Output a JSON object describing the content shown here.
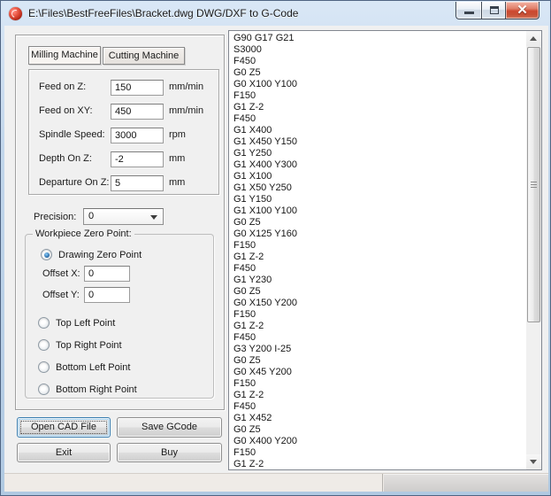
{
  "window": {
    "title": "E:\\Files\\BestFreeFiles\\Bracket.dwg DWG/DXF to G-Code",
    "icons": {
      "app": "red-disc-icon",
      "minimize": "minimize-icon",
      "maximize": "maximize-icon",
      "close": "close-icon"
    }
  },
  "tabs": [
    {
      "label": "Milling Machine",
      "active": true
    },
    {
      "label": "Cutting Machine",
      "active": false
    }
  ],
  "fields": [
    {
      "label": "Feed on Z:",
      "value": "150",
      "unit": "mm/min"
    },
    {
      "label": "Feed on XY:",
      "value": "450",
      "unit": "mm/min"
    },
    {
      "label": "Spindle Speed:",
      "value": "3000",
      "unit": "rpm"
    },
    {
      "label": "Depth On Z:",
      "value": "-2",
      "unit": "mm"
    },
    {
      "label": "Departure On Z:",
      "value": "5",
      "unit": "mm"
    }
  ],
  "precision": {
    "label": "Precision:",
    "value": "0"
  },
  "workpiece": {
    "title": "Workpiece Zero Point:",
    "drawing_radio": {
      "label": "Drawing Zero Point",
      "selected": true
    },
    "offsets": [
      {
        "label": "Offset X:",
        "value": "0"
      },
      {
        "label": "Offset Y:",
        "value": "0"
      }
    ],
    "corner_radios": [
      {
        "label": "Top Left Point",
        "selected": false
      },
      {
        "label": "Top Right Point",
        "selected": false
      },
      {
        "label": "Bottom Left Point",
        "selected": false
      },
      {
        "label": "Bottom Right Point",
        "selected": false
      }
    ]
  },
  "buttons": {
    "open": "Open CAD File",
    "save": "Save GCode",
    "exit": "Exit",
    "buy": "Buy"
  },
  "colors": {
    "accent_close": "#cc4830",
    "radio_selected": "#2f71ad",
    "default_button_border": "#3c7fb1"
  },
  "gcode": {
    "lines": [
      "G90 G17 G21",
      "S3000",
      "F450",
      "G0 Z5",
      "G0 X100 Y100",
      "F150",
      "G1 Z-2",
      "F450",
      "G1 X400",
      "G1 X450 Y150",
      "G1 Y250",
      "G1 X400 Y300",
      "G1 X100",
      "G1 X50 Y250",
      "G1 Y150",
      "G1 X100 Y100",
      "G0 Z5",
      "G0 X125 Y160",
      "F150",
      "G1 Z-2",
      "F450",
      "G1 Y230",
      "G0 Z5",
      "G0 X150 Y200",
      "F150",
      "G1 Z-2",
      "F450",
      "G3 Y200 I-25",
      "G0 Z5",
      "G0 X45 Y200",
      "F150",
      "G1 Z-2",
      "F450",
      "G1 X452",
      "G0 Z5",
      "G0 X400 Y200",
      "F150",
      "G1 Z-2"
    ]
  }
}
